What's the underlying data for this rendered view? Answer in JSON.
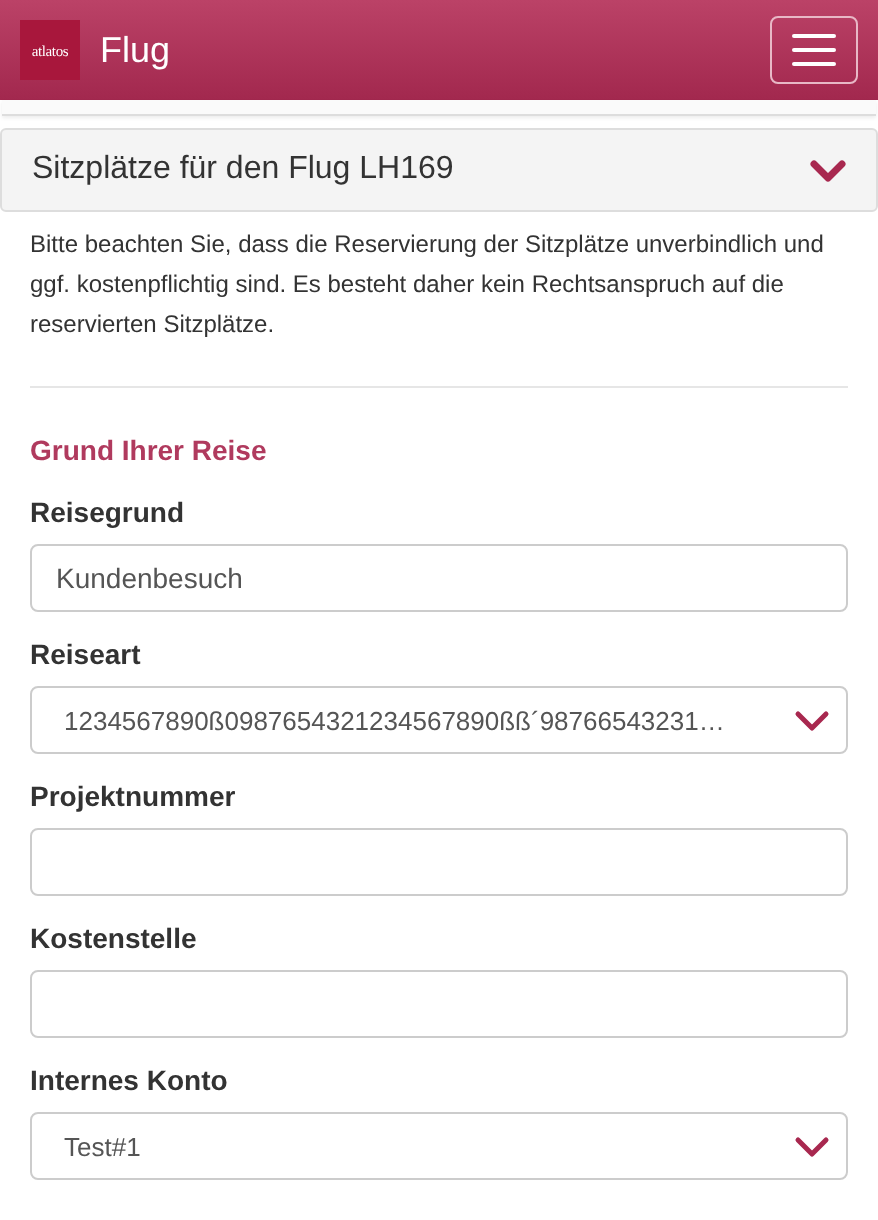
{
  "header": {
    "logo": "atlatos",
    "title": "Flug"
  },
  "panel": {
    "title": "Sitzplätze für den Flug LH169",
    "expanded": true
  },
  "notice": "Bitte beachten Sie, dass die Reservierung der Sitzplätze unverbindlich und ggf. kostenpflichtig sind. Es besteht daher kein Rechtsanspruch auf die reservierten Sitzplätze.",
  "section_title": "Grund Ihrer Reise",
  "fields": [
    {
      "label": "Reisegrund",
      "kind": "text",
      "value": "Kundenbesuch"
    },
    {
      "label": "Reiseart",
      "kind": "select",
      "value": "1234567890ß0987654321234567890ßß´98766543231…"
    },
    {
      "label": "Projektnummer",
      "kind": "text"
    },
    {
      "label": "Kostenstelle",
      "kind": "text"
    },
    {
      "label": "Internes Konto",
      "kind": "select",
      "value": "Test#1"
    }
  ]
}
